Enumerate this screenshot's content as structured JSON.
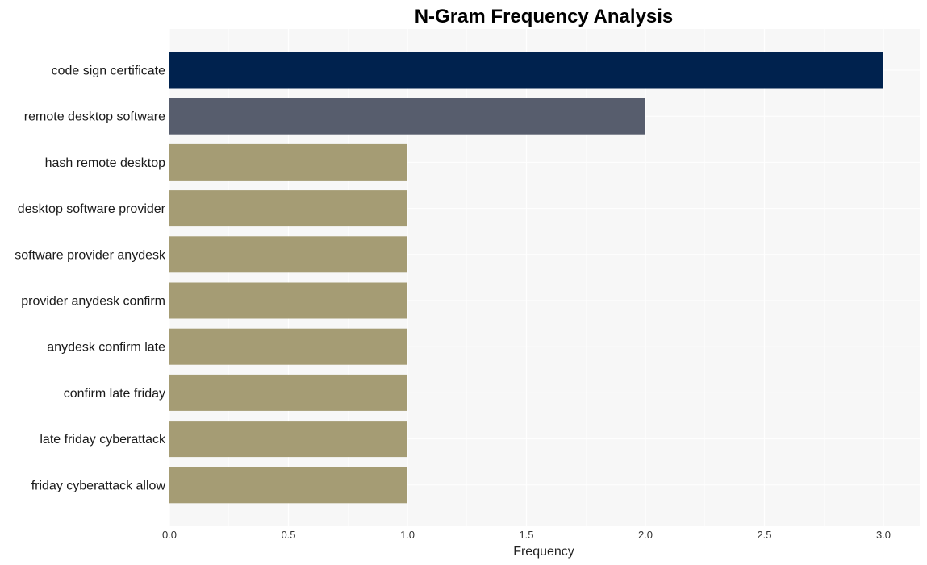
{
  "chart_data": {
    "type": "bar",
    "orientation": "horizontal",
    "title": "N-Gram Frequency Analysis",
    "xlabel": "Frequency",
    "ylabel": "",
    "xlim": [
      0,
      3.15
    ],
    "xticks": [
      0.0,
      0.5,
      1.0,
      1.5,
      2.0,
      2.5,
      3.0
    ],
    "xtick_labels": [
      "0.0",
      "0.5",
      "1.0",
      "1.5",
      "2.0",
      "2.5",
      "3.0"
    ],
    "grid": true,
    "categories": [
      "code sign certificate",
      "remote desktop software",
      "hash remote desktop",
      "desktop software provider",
      "software provider anydesk",
      "provider anydesk confirm",
      "anydesk confirm late",
      "confirm late friday",
      "late friday cyberattack",
      "friday cyberattack allow"
    ],
    "values": [
      3,
      2,
      1,
      1,
      1,
      1,
      1,
      1,
      1,
      1
    ],
    "colors": [
      "#00224e",
      "#575d6d",
      "#a59c74",
      "#a59c74",
      "#a59c74",
      "#a59c74",
      "#a59c74",
      "#a59c74",
      "#a59c74",
      "#a59c74"
    ],
    "background": "#f7f7f7",
    "grid_color": "#ffffff"
  }
}
